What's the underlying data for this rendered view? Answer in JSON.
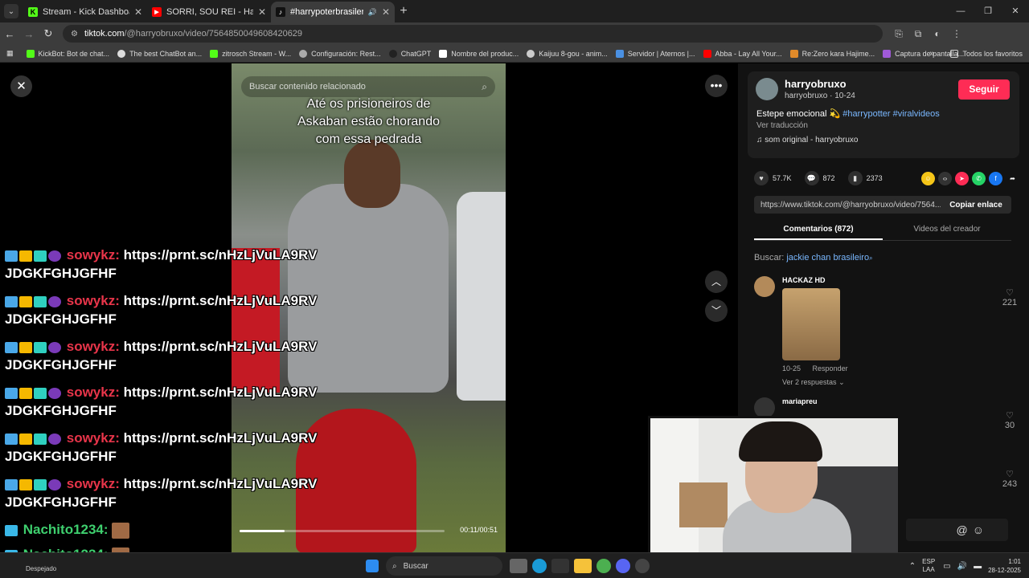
{
  "browser": {
    "tabs": [
      {
        "label": "Stream - Kick Dashboard",
        "favicon": "K",
        "color": "#53fc18",
        "active": false
      },
      {
        "label": "SORRI, SOU REI - Harry - Brega",
        "favicon": "▶",
        "color": "#ff0000",
        "active": false
      },
      {
        "label": "#harrypoterbrasilero | TikTok",
        "favicon": "♪",
        "color": "#111111",
        "active": true
      }
    ],
    "new_tab_glyph": "+",
    "url_host": "tiktok.com",
    "url_path": "/@harryobruxo/video/7564850049608420629",
    "bookmarks": [
      "KickBot: Bot de chat...",
      "The best ChatBot an...",
      "zitrosch Stream - W...",
      "Configuración: Rest...",
      "ChatGPT",
      "Nombre del produc...",
      "Kaijuu 8-gou - anim...",
      "Servidor | Aternos |...",
      "Abba - Lay All Your...",
      "Re:Zero kara Hajime...",
      "Captura de pantalla..."
    ],
    "bookmarks_more": "»",
    "all_favorites": "Todos los favoritos"
  },
  "video": {
    "search_placeholder": "Buscar contenido relacionado",
    "caption_lines": [
      "Até os prisioneiros de",
      "Askaban estão chorando",
      "com essa pedrada"
    ],
    "time": "00:11/00:51",
    "progress_fraction": 0.22
  },
  "creator": {
    "name": "harryobruxo",
    "sub": "harryobruxo · 10-24",
    "follow_label": "Seguir",
    "description_text": "Estepe emocional",
    "hashtags": "#harrypotter #viralvideos",
    "translate_label": "Ver traducción",
    "sound": "som original - harryobruxo"
  },
  "stats": {
    "likes": "57.7K",
    "comments": "872",
    "saves": "2373"
  },
  "share_link": {
    "url": "https://www.tiktok.com/@harryobruxo/video/7564...",
    "copy_label": "Copiar enlace"
  },
  "panel_tabs": {
    "comments": "Comentarios (872)",
    "creator_videos": "Videos del creador"
  },
  "search_suggestion": {
    "prefix": "Buscar:",
    "query": "jackie chan brasileiro"
  },
  "comments": [
    {
      "user": "HACKAZ HD",
      "date": "10-25",
      "reply_label": "Responder",
      "replies": "Ver 2 respuestas",
      "likes": "221"
    },
    {
      "user": "mariapreu",
      "likes": "30"
    },
    {
      "likes": "243"
    }
  ],
  "chat": {
    "repeated": [
      {
        "user": "sowykz:",
        "text": "https://prnt.sc/nHzLjVuLA9RV",
        "text2": "JDGKFGHJGFHF"
      },
      {
        "user": "sowykz:",
        "text": "https://prnt.sc/nHzLjVuLA9RV",
        "text2": "JDGKFGHJGFHF"
      },
      {
        "user": "sowykz:",
        "text": "https://prnt.sc/nHzLjVuLA9RV",
        "text2": "JDGKFGHJGFHF"
      },
      {
        "user": "sowykz:",
        "text": "https://prnt.sc/nHzLjVuLA9RV",
        "text2": "JDGKFGHJGFHF"
      },
      {
        "user": "sowykz:",
        "text": "https://prnt.sc/nHzLjVuLA9RV",
        "text2": "JDGKFGHJGFHF"
      },
      {
        "user": "sowykz:",
        "text": "https://prnt.sc/nHzLjVuLA9RV",
        "text2": "JDGKFGHJGFHF"
      }
    ],
    "nachito": "Nachito1234:"
  },
  "taskbar": {
    "left_label": "Despejado",
    "search_label": "Buscar",
    "lang_top": "ESP",
    "lang_bottom": "LAA",
    "time": "1:01",
    "date": "28-12-2025"
  }
}
